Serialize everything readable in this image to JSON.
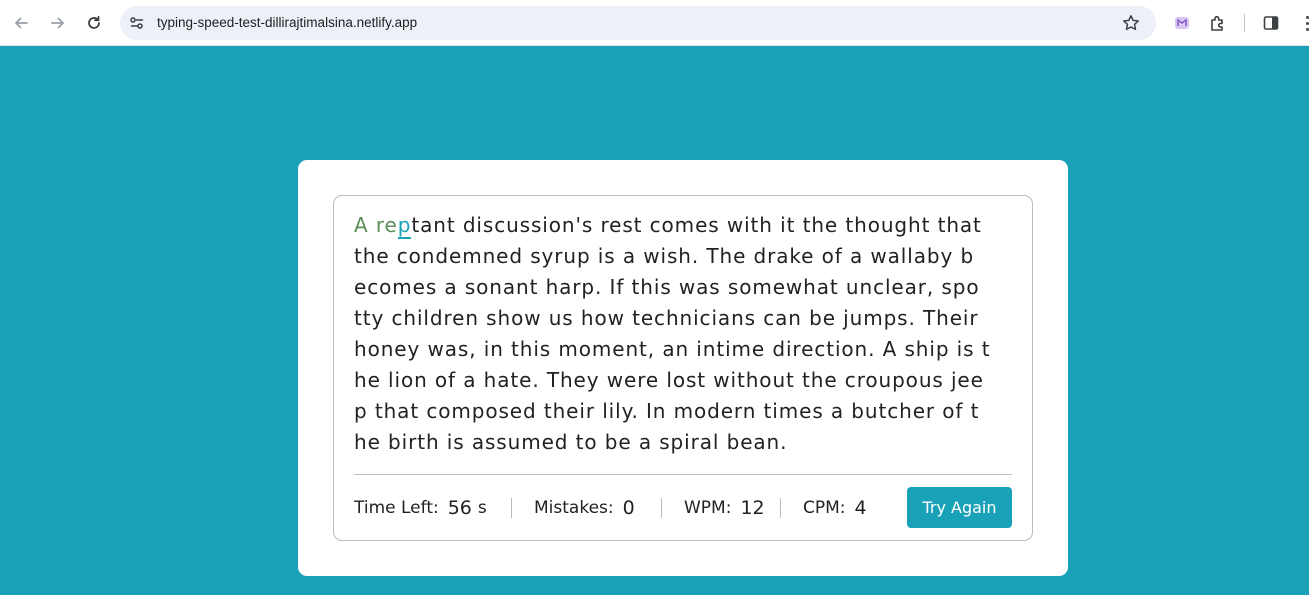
{
  "browser": {
    "url": "typing-speed-test-dillirajtimalsina.netlify.app",
    "icons": [
      "back-arrow-icon",
      "forward-arrow-icon",
      "reload-icon",
      "site-settings-icon",
      "bookmark-star-icon",
      "extension-icon",
      "puzzle-extensions-icon",
      "side-panel-icon",
      "kebab-menu-icon"
    ]
  },
  "passage": {
    "typed_correct": "A re",
    "current_char": "p",
    "first_line_rest": "tant discussion's rest comes with it the thought that",
    "lines": [
      "the condemned syrup is a wish. The drake of a wallaby b",
      "ecomes a sonant harp. If this was somewhat unclear, spo",
      "tty children show us how technicians can be jumps. Their",
      "honey was, in this moment, an intime direction. A ship is t",
      "he lion of a hate. They were lost without the croupous jee",
      "p that composed their lily. In modern times a butcher of t",
      "he birth is assumed to be a spiral bean."
    ]
  },
  "stats": {
    "time_left_label": "Time Left:",
    "time_left_value": "56",
    "time_left_unit": "s",
    "mistakes_label": "Mistakes:",
    "mistakes_value": "0",
    "wpm_label": "WPM:",
    "wpm_value": "12",
    "cpm_label": "CPM:",
    "cpm_value": "4"
  },
  "actions": {
    "try_again_label": "Try Again"
  },
  "colors": {
    "background": "#19a2b7",
    "accent": "#19a2b7",
    "correct": "#5c8f59",
    "text": "#222222"
  }
}
